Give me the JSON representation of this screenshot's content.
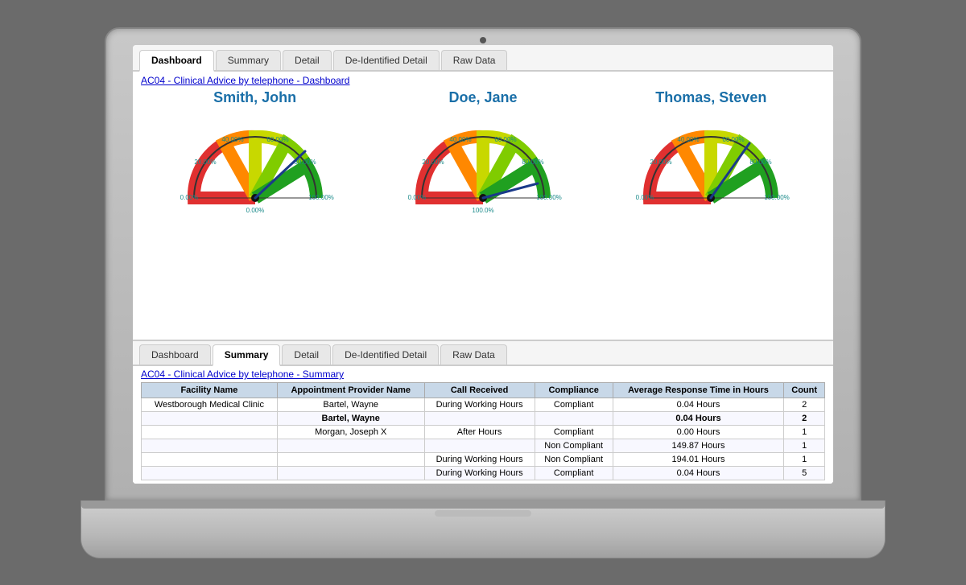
{
  "laptop": {
    "camera_dot": "●"
  },
  "tabs_top": {
    "items": [
      {
        "label": "Dashboard",
        "active": true
      },
      {
        "label": "Summary",
        "active": false
      },
      {
        "label": "Detail",
        "active": false
      },
      {
        "label": "De-Identified Detail",
        "active": false
      },
      {
        "label": "Raw Data",
        "active": false
      }
    ]
  },
  "dashboard": {
    "title": "AC04  -  Clinical Advice by telephone - Dashboard",
    "gauges": [
      {
        "name": "Smith, John",
        "needle_angle": 55,
        "labels": [
          "0.00%",
          "20.00%",
          "40.00%",
          "60.00%",
          "80.00%",
          "100.00%"
        ]
      },
      {
        "name": "Doe, Jane",
        "needle_angle": 90,
        "labels": [
          "0.00%",
          "20.00%",
          "40.00%",
          "60.00%",
          "80.00%",
          "100.00%"
        ]
      },
      {
        "name": "Thomas, Steven",
        "needle_angle": 45,
        "labels": [
          "0.00%",
          "20.00%",
          "40.00%",
          "60.00%",
          "80.00%",
          "100.00%"
        ]
      }
    ]
  },
  "tabs_bottom": {
    "items": [
      {
        "label": "Dashboard",
        "active": false
      },
      {
        "label": "Summary",
        "active": true
      },
      {
        "label": "Detail",
        "active": false
      },
      {
        "label": "De-Identified Detail",
        "active": false
      },
      {
        "label": "Raw Data",
        "active": false
      }
    ]
  },
  "summary": {
    "title": "AC04  -  Clinical Advice by telephone  - Summary",
    "table": {
      "headers": [
        "Facility Name",
        "Appointment Provider Name",
        "Call Received",
        "Compliance",
        "Average Response Time in Hours",
        "Count"
      ],
      "rows": [
        {
          "cells": [
            "Westborough Medical Clinic",
            "Bartel, Wayne",
            "During Working Hours",
            "Compliant",
            "0.04 Hours",
            "2"
          ],
          "bold": false
        },
        {
          "cells": [
            "",
            "Bartel, Wayne",
            "",
            "",
            "0.04 Hours",
            "2"
          ],
          "bold": true
        },
        {
          "cells": [
            "",
            "Morgan, Joseph X",
            "After Hours",
            "Compliant",
            "0.00 Hours",
            "1"
          ],
          "bold": false
        },
        {
          "cells": [
            "",
            "",
            "",
            "Non Compliant",
            "149.87 Hours",
            "1"
          ],
          "bold": false
        },
        {
          "cells": [
            "",
            "",
            "During Working Hours",
            "Non Compliant",
            "194.01 Hours",
            "1"
          ],
          "bold": false
        },
        {
          "cells": [
            "",
            "",
            "During Working Hours",
            "Compliant",
            "0.04 Hours",
            "5"
          ],
          "bold": false
        }
      ]
    }
  }
}
